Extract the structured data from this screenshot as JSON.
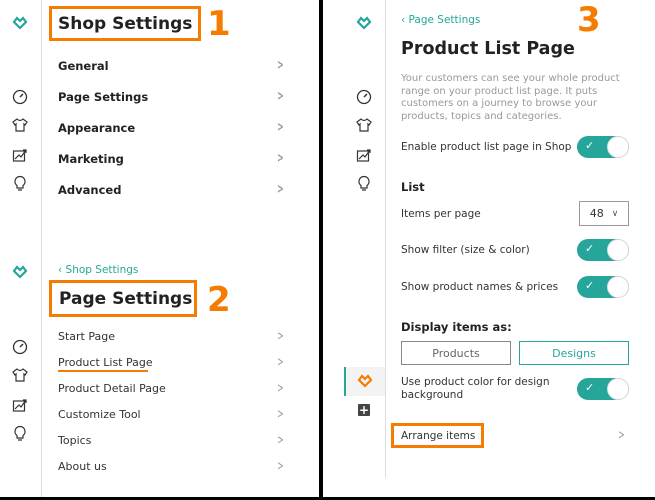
{
  "colors": {
    "accent": "#26a69a",
    "highlight": "#f57c00"
  },
  "panel1": {
    "title": "Shop Settings",
    "step": "1",
    "items": [
      "General",
      "Page Settings",
      "Appearance",
      "Marketing",
      "Advanced"
    ]
  },
  "panel2": {
    "back": "Shop Settings",
    "title": "Page Settings",
    "step": "2",
    "items": [
      "Start Page",
      "Product List Page",
      "Product Detail Page",
      "Customize Tool",
      "Topics",
      "About us"
    ],
    "highlighted_item": "Product List Page"
  },
  "panel3": {
    "back": "Page Settings",
    "title": "Product List Page",
    "step": "3",
    "description": "Your customers can see your whole product range on your product list page. It puts customers on a journey to browse your products, topics and categories.",
    "enable_label": "Enable product list page in Shop",
    "enable_on": true,
    "list_heading": "List",
    "items_per_page_label": "Items per page",
    "items_per_page_value": "48",
    "show_filter_label": "Show filter (size & color)",
    "show_filter_on": true,
    "show_names_label": "Show product names & prices",
    "show_names_on": true,
    "display_heading": "Display items as:",
    "display_options": [
      "Products",
      "Designs"
    ],
    "display_selected": "Designs",
    "product_color_label": "Use product color for design background",
    "product_color_on": true,
    "arrange_label": "Arrange items"
  },
  "sidebar_icons": [
    "logo-heart-icon",
    "dashboard-gauge-icon",
    "tshirt-icon",
    "marketing-chart-icon",
    "lightbulb-icon"
  ]
}
